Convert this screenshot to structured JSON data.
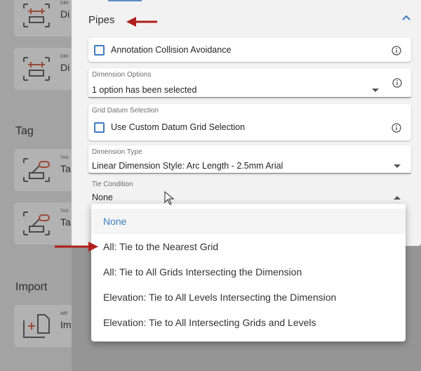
{
  "background": {
    "cards": [
      {
        "small": "DIM",
        "label": "Di"
      },
      {
        "small": "DIM",
        "label": "Di"
      },
      {
        "small": "TAG",
        "label": "Ta"
      },
      {
        "small": "TAG",
        "label": "Ta"
      },
      {
        "small": "IMP",
        "label": "Im"
      }
    ],
    "headings": {
      "tag": "Tag",
      "import": "Import"
    }
  },
  "section": {
    "title": "Pipes"
  },
  "fields": {
    "collision": {
      "label": "Annotation Collision Avoidance",
      "checked": false
    },
    "dimension_options": {
      "label": "Dimension Options",
      "value": "1 option has been selected"
    },
    "grid_datum": {
      "label": "Grid Datum Selection",
      "checkbox_label": "Use Custom Datum Grid Selection",
      "checked": false
    },
    "dimension_type": {
      "label": "Dimension Type",
      "value": "Linear Dimension Style: Arc Length - 2.5mm Arial"
    },
    "tie_condition": {
      "label": "Tie Condition",
      "value": "None"
    }
  },
  "dropdown": {
    "options": [
      "None",
      "All: Tie to the Nearest Grid",
      "All: Tie to All Grids Intersecting the Dimension",
      "Elevation: Tie to All Levels Intersecting the Dimension",
      "Elevation: Tie to All Intersecting Grids and Levels"
    ],
    "selected_index": 0
  },
  "colors": {
    "accent": "#3f7bbf",
    "annotation_arrow": "#b01e1e"
  },
  "icons": {
    "collapse": "chevron-up-icon",
    "info": "info-icon",
    "arrow": "red-arrow-icon"
  }
}
